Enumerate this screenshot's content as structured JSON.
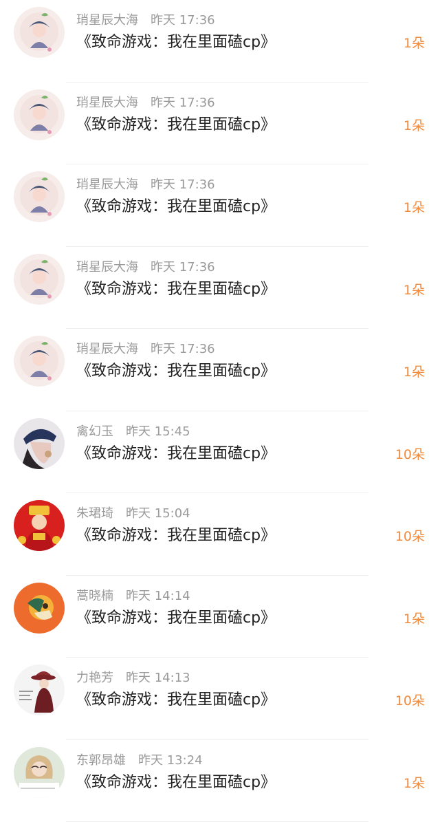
{
  "list": {
    "items": [
      {
        "name": "琑星辰大海",
        "time": "昨天 17:36",
        "title": "《致命游戏：我在里面磕cp》",
        "count": "1朵",
        "avatar": "anime-character-avatar"
      },
      {
        "name": "琑星辰大海",
        "time": "昨天 17:36",
        "title": "《致命游戏：我在里面磕cp》",
        "count": "1朵",
        "avatar": "anime-character-avatar"
      },
      {
        "name": "琑星辰大海",
        "time": "昨天 17:36",
        "title": "《致命游戏：我在里面磕cp》",
        "count": "1朵",
        "avatar": "anime-character-avatar"
      },
      {
        "name": "琑星辰大海",
        "time": "昨天 17:36",
        "title": "《致命游戏：我在里面磕cp》",
        "count": "1朵",
        "avatar": "anime-character-avatar"
      },
      {
        "name": "琑星辰大海",
        "time": "昨天 17:36",
        "title": "《致命游戏：我在里面磕cp》",
        "count": "1朵",
        "avatar": "anime-character-avatar"
      },
      {
        "name": "禽幻玉",
        "time": "昨天 15:45",
        "title": "《致命游戏：我在里面磕cp》",
        "count": "10朵",
        "avatar": "woman-in-cap-avatar"
      },
      {
        "name": "朱珺琦",
        "time": "昨天 15:04",
        "title": "《致命游戏：我在里面磕cp》",
        "count": "10朵",
        "avatar": "god-of-wealth-avatar"
      },
      {
        "name": "蒿晓楠",
        "time": "昨天 14:14",
        "title": "《致命游戏：我在里面磕cp》",
        "count": "1朵",
        "avatar": "orange-illustration-avatar"
      },
      {
        "name": "力艳芳",
        "time": "昨天 14:13",
        "title": "《致命游戏：我在里面磕cp》",
        "count": "10朵",
        "avatar": "girl-red-hat-avatar"
      },
      {
        "name": "东郭昂雄",
        "time": "昨天 13:24",
        "title": "《致命游戏：我在里面磕cp》",
        "count": "1朵",
        "avatar": "girl-photo-avatar"
      }
    ]
  }
}
